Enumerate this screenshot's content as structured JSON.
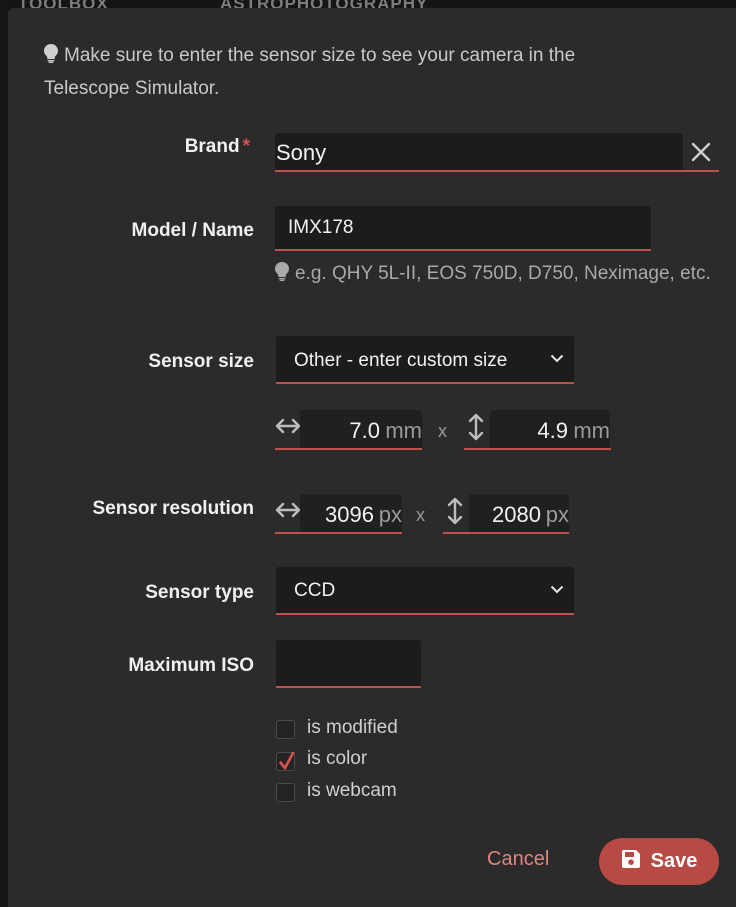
{
  "background": {
    "tab_left": "TOOLBOX",
    "tab_right": "ASTROPHOTOGRAPHY"
  },
  "hint": {
    "text": "Make sure to enter the sensor size to see your camera in the Telescope Simulator."
  },
  "brand": {
    "label": "Brand",
    "required_mark": "*",
    "value": "Sony"
  },
  "model": {
    "label": "Model / Name",
    "value": "IMX178",
    "help": "e.g. QHY 5L-II, EOS 750D, D750, Neximage, etc."
  },
  "sensor_size": {
    "label": "Sensor size",
    "selected": "Other - enter custom size",
    "width": "7.0",
    "height": "4.9",
    "unit": "mm",
    "separator": "x"
  },
  "sensor_resolution": {
    "label": "Sensor resolution",
    "width": "3096",
    "height": "2080",
    "unit": "px",
    "separator": "x"
  },
  "sensor_type": {
    "label": "Sensor type",
    "selected": "CCD"
  },
  "max_iso": {
    "label": "Maximum ISO",
    "value": ""
  },
  "checkboxes": [
    {
      "label": "is modified",
      "checked": false
    },
    {
      "label": "is color",
      "checked": true
    },
    {
      "label": "is webcam",
      "checked": false
    }
  ],
  "actions": {
    "cancel": "Cancel",
    "save": "Save"
  },
  "colors": {
    "accent": "#c0504d",
    "dialog_bg": "#2b2b2b",
    "field_bg": "#1c1c1c",
    "save_bg": "#b84a45"
  }
}
